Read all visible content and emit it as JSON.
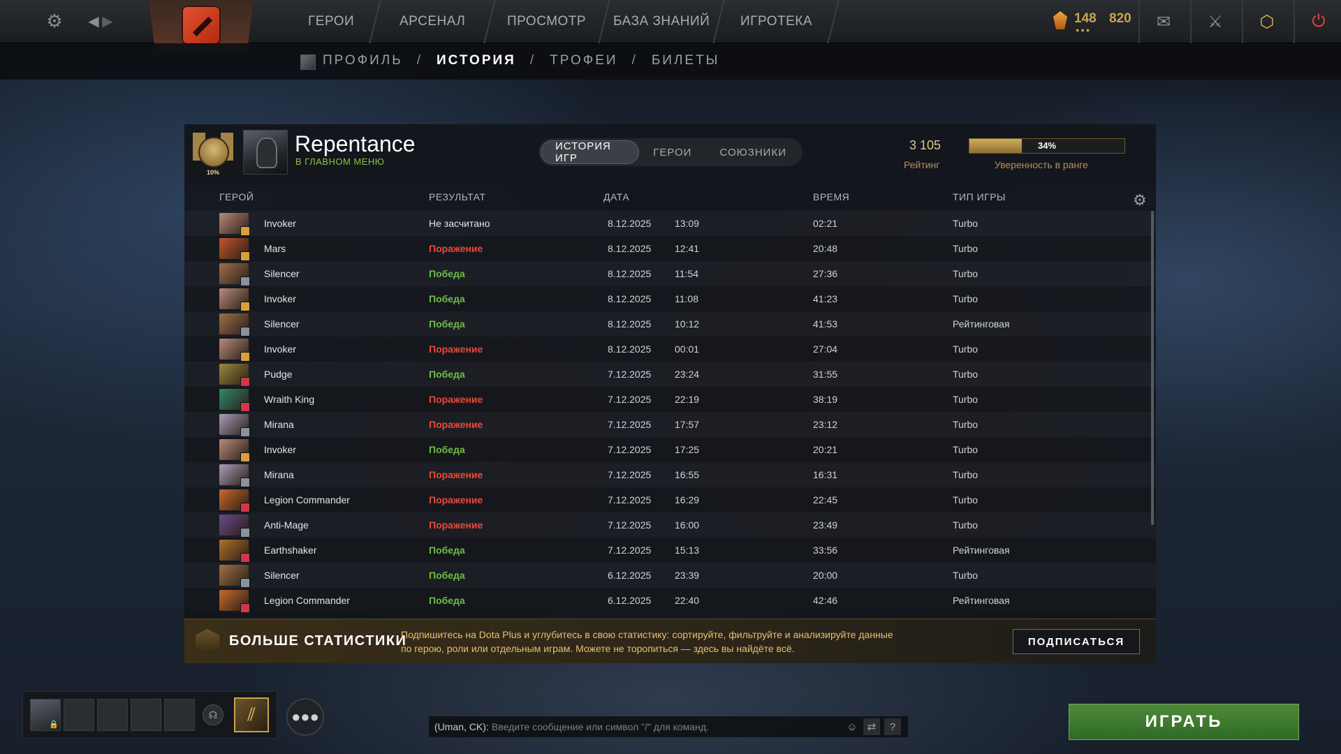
{
  "topbar": {
    "nav": [
      "ГЕРОИ",
      "АРСЕНАЛ",
      "ПРОСМОТР",
      "БАЗА ЗНАНИЙ",
      "ИГРОТЕКА"
    ],
    "shards": "148",
    "gold": "820"
  },
  "subnav": {
    "items": [
      "ПРОФИЛЬ",
      "ИСТОРИЯ",
      "ТРОФЕИ",
      "БИЛЕТЫ"
    ],
    "separator": "/"
  },
  "profile": {
    "name": "Repentance",
    "status": "В ГЛАВНОМ МЕНЮ",
    "medal_pct": "10%",
    "rating": "3 105",
    "rating_label": "Рейтинг",
    "confidence": "34%",
    "confidence_value": 0.34,
    "confidence_label": "Уверенность в ранге"
  },
  "tabs": [
    "ИСТОРИЯ ИГР",
    "ГЕРОИ",
    "СОЮЗНИКИ"
  ],
  "columns": {
    "hero": "ГЕРОЙ",
    "result": "РЕЗУЛЬТАТ",
    "date": "ДАТА",
    "duration": "ВРЕМЯ",
    "type": "ТИП ИГРЫ"
  },
  "matches": [
    {
      "hero": "Invoker",
      "result": "Не засчитано",
      "kind": "none",
      "date": "8.12.2025",
      "time": "13:09",
      "duration": "02:21",
      "type": "Turbo",
      "color": "#b98a7a",
      "badge": "#d8a03a"
    },
    {
      "hero": "Mars",
      "result": "Поражение",
      "kind": "loss",
      "date": "8.12.2025",
      "time": "12:41",
      "duration": "20:48",
      "type": "Turbo",
      "color": "#c4562a",
      "badge": "#d8a03a"
    },
    {
      "hero": "Silencer",
      "result": "Победа",
      "kind": "win",
      "date": "8.12.2025",
      "time": "11:54",
      "duration": "27:36",
      "type": "Turbo",
      "color": "#a0704a",
      "badge": "#8a92a0"
    },
    {
      "hero": "Invoker",
      "result": "Победа",
      "kind": "win",
      "date": "8.12.2025",
      "time": "11:08",
      "duration": "41:23",
      "type": "Turbo",
      "color": "#b98a7a",
      "badge": "#d8a03a"
    },
    {
      "hero": "Silencer",
      "result": "Победа",
      "kind": "win",
      "date": "8.12.2025",
      "time": "10:12",
      "duration": "41:53",
      "type": "Рейтинговая",
      "color": "#a0704a",
      "badge": "#8a92a0"
    },
    {
      "hero": "Invoker",
      "result": "Поражение",
      "kind": "loss",
      "date": "8.12.2025",
      "time": "00:01",
      "duration": "27:04",
      "type": "Turbo",
      "color": "#b98a7a",
      "badge": "#d8a03a"
    },
    {
      "hero": "Pudge",
      "result": "Победа",
      "kind": "win",
      "date": "7.12.2025",
      "time": "23:24",
      "duration": "31:55",
      "type": "Turbo",
      "color": "#9a8a3a",
      "badge": "#d0384a"
    },
    {
      "hero": "Wraith King",
      "result": "Поражение",
      "kind": "loss",
      "date": "7.12.2025",
      "time": "22:19",
      "duration": "38:19",
      "type": "Turbo",
      "color": "#2e8a6a",
      "badge": "#d0384a"
    },
    {
      "hero": "Mirana",
      "result": "Поражение",
      "kind": "loss",
      "date": "7.12.2025",
      "time": "17:57",
      "duration": "23:12",
      "type": "Turbo",
      "color": "#a8a0b8",
      "badge": "#8a92a0"
    },
    {
      "hero": "Invoker",
      "result": "Победа",
      "kind": "win",
      "date": "7.12.2025",
      "time": "17:25",
      "duration": "20:21",
      "type": "Turbo",
      "color": "#b98a7a",
      "badge": "#d8a03a"
    },
    {
      "hero": "Mirana",
      "result": "Поражение",
      "kind": "loss",
      "date": "7.12.2025",
      "time": "16:55",
      "duration": "16:31",
      "type": "Turbo",
      "color": "#a8a0b8",
      "badge": "#8a92a0"
    },
    {
      "hero": "Legion Commander",
      "result": "Поражение",
      "kind": "loss",
      "date": "7.12.2025",
      "time": "16:29",
      "duration": "22:45",
      "type": "Turbo",
      "color": "#c86a2a",
      "badge": "#d0384a"
    },
    {
      "hero": "Anti-Mage",
      "result": "Поражение",
      "kind": "loss",
      "date": "7.12.2025",
      "time": "16:00",
      "duration": "23:49",
      "type": "Turbo",
      "color": "#6a4a8a",
      "badge": "#8a92a0"
    },
    {
      "hero": "Earthshaker",
      "result": "Победа",
      "kind": "win",
      "date": "7.12.2025",
      "time": "15:13",
      "duration": "33:56",
      "type": "Рейтинговая",
      "color": "#b0702a",
      "badge": "#d0384a"
    },
    {
      "hero": "Silencer",
      "result": "Победа",
      "kind": "win",
      "date": "6.12.2025",
      "time": "23:39",
      "duration": "20:00",
      "type": "Turbo",
      "color": "#a0704a",
      "badge": "#8a92a0"
    },
    {
      "hero": "Legion Commander",
      "result": "Победа",
      "kind": "win",
      "date": "6.12.2025",
      "time": "22:40",
      "duration": "42:46",
      "type": "Рейтинговая",
      "color": "#c86a2a",
      "badge": "#d0384a"
    }
  ],
  "banner": {
    "title": "БОЛЬШЕ СТАТИСТИКИ",
    "text": "Подпишитесь на Dota Plus и углубитесь в свою статистику: сортируйте, фильтруйте и анализируйте данные по герою, роли или отдельным играм. Можете не торопиться — здесь вы найдёте всё.",
    "button": "ПОДПИСАТЬСЯ"
  },
  "chat": {
    "channel": "(Uman, CK):",
    "placeholder": "Введите сообщение или символ \"/\" для команд."
  },
  "play_button": "ИГРАТЬ",
  "icons": {
    "settings": "gear-icon",
    "back": "arrow-left-icon",
    "forward": "arrow-right-icon",
    "mail": "mail-icon",
    "armory": "armory-icon",
    "dota_plus": "dota-plus-icon",
    "power": "power-icon"
  }
}
